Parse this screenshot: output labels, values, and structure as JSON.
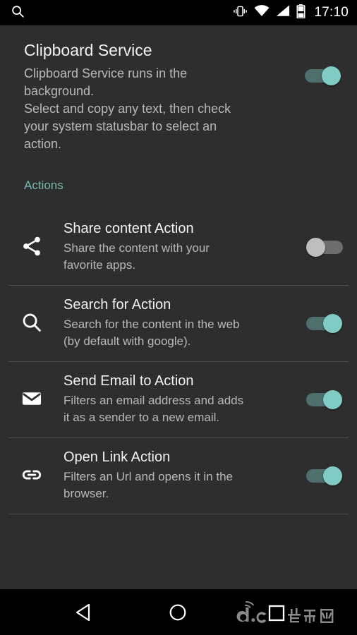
{
  "statusbar": {
    "search_icon": "search-icon",
    "icons": [
      "vibrate-icon",
      "wifi-icon",
      "signal-icon",
      "battery-icon"
    ],
    "time": "17:10"
  },
  "header": {
    "title": "Clipboard Service",
    "description": "Clipboard Service runs in the background.\nSelect and copy any text, then check your system statusbar to select an action.",
    "switch_state": "on"
  },
  "section": {
    "label": "Actions",
    "accent_color": "#79b7ae"
  },
  "rows": [
    {
      "icon": "share-icon",
      "title": "Share content Action",
      "subtitle": "Share the content with your favorite apps.",
      "switch_state": "off"
    },
    {
      "icon": "search-icon",
      "title": "Search for Action",
      "subtitle": "Search for the content in the web (by default with google).",
      "switch_state": "on"
    },
    {
      "icon": "mail-icon",
      "title": "Send Email to Action",
      "subtitle": "Filters an email address and adds it as a sender to a new email.",
      "switch_state": "on"
    },
    {
      "icon": "link-icon",
      "title": "Open Link Action",
      "subtitle": "Filters an Url and opens it in the browser.",
      "switch_state": "on"
    }
  ],
  "navbar": {
    "back": "back-icon",
    "home": "home-icon",
    "recents": "recents-icon",
    "watermark_text": "当乐网",
    "watermark_prefix": "d.c"
  },
  "colors": {
    "background": "#2e2e2e",
    "statusbar": "#000000",
    "primary_text": "#f2f2f2",
    "secondary_text": "#b9b9b9",
    "switch_on_thumb": "#80cbc4",
    "switch_on_track": "#4e6f6b",
    "switch_off_thumb": "#bdbdbd",
    "switch_off_track": "#6e6e6e",
    "divider": "#4f4f4f"
  }
}
